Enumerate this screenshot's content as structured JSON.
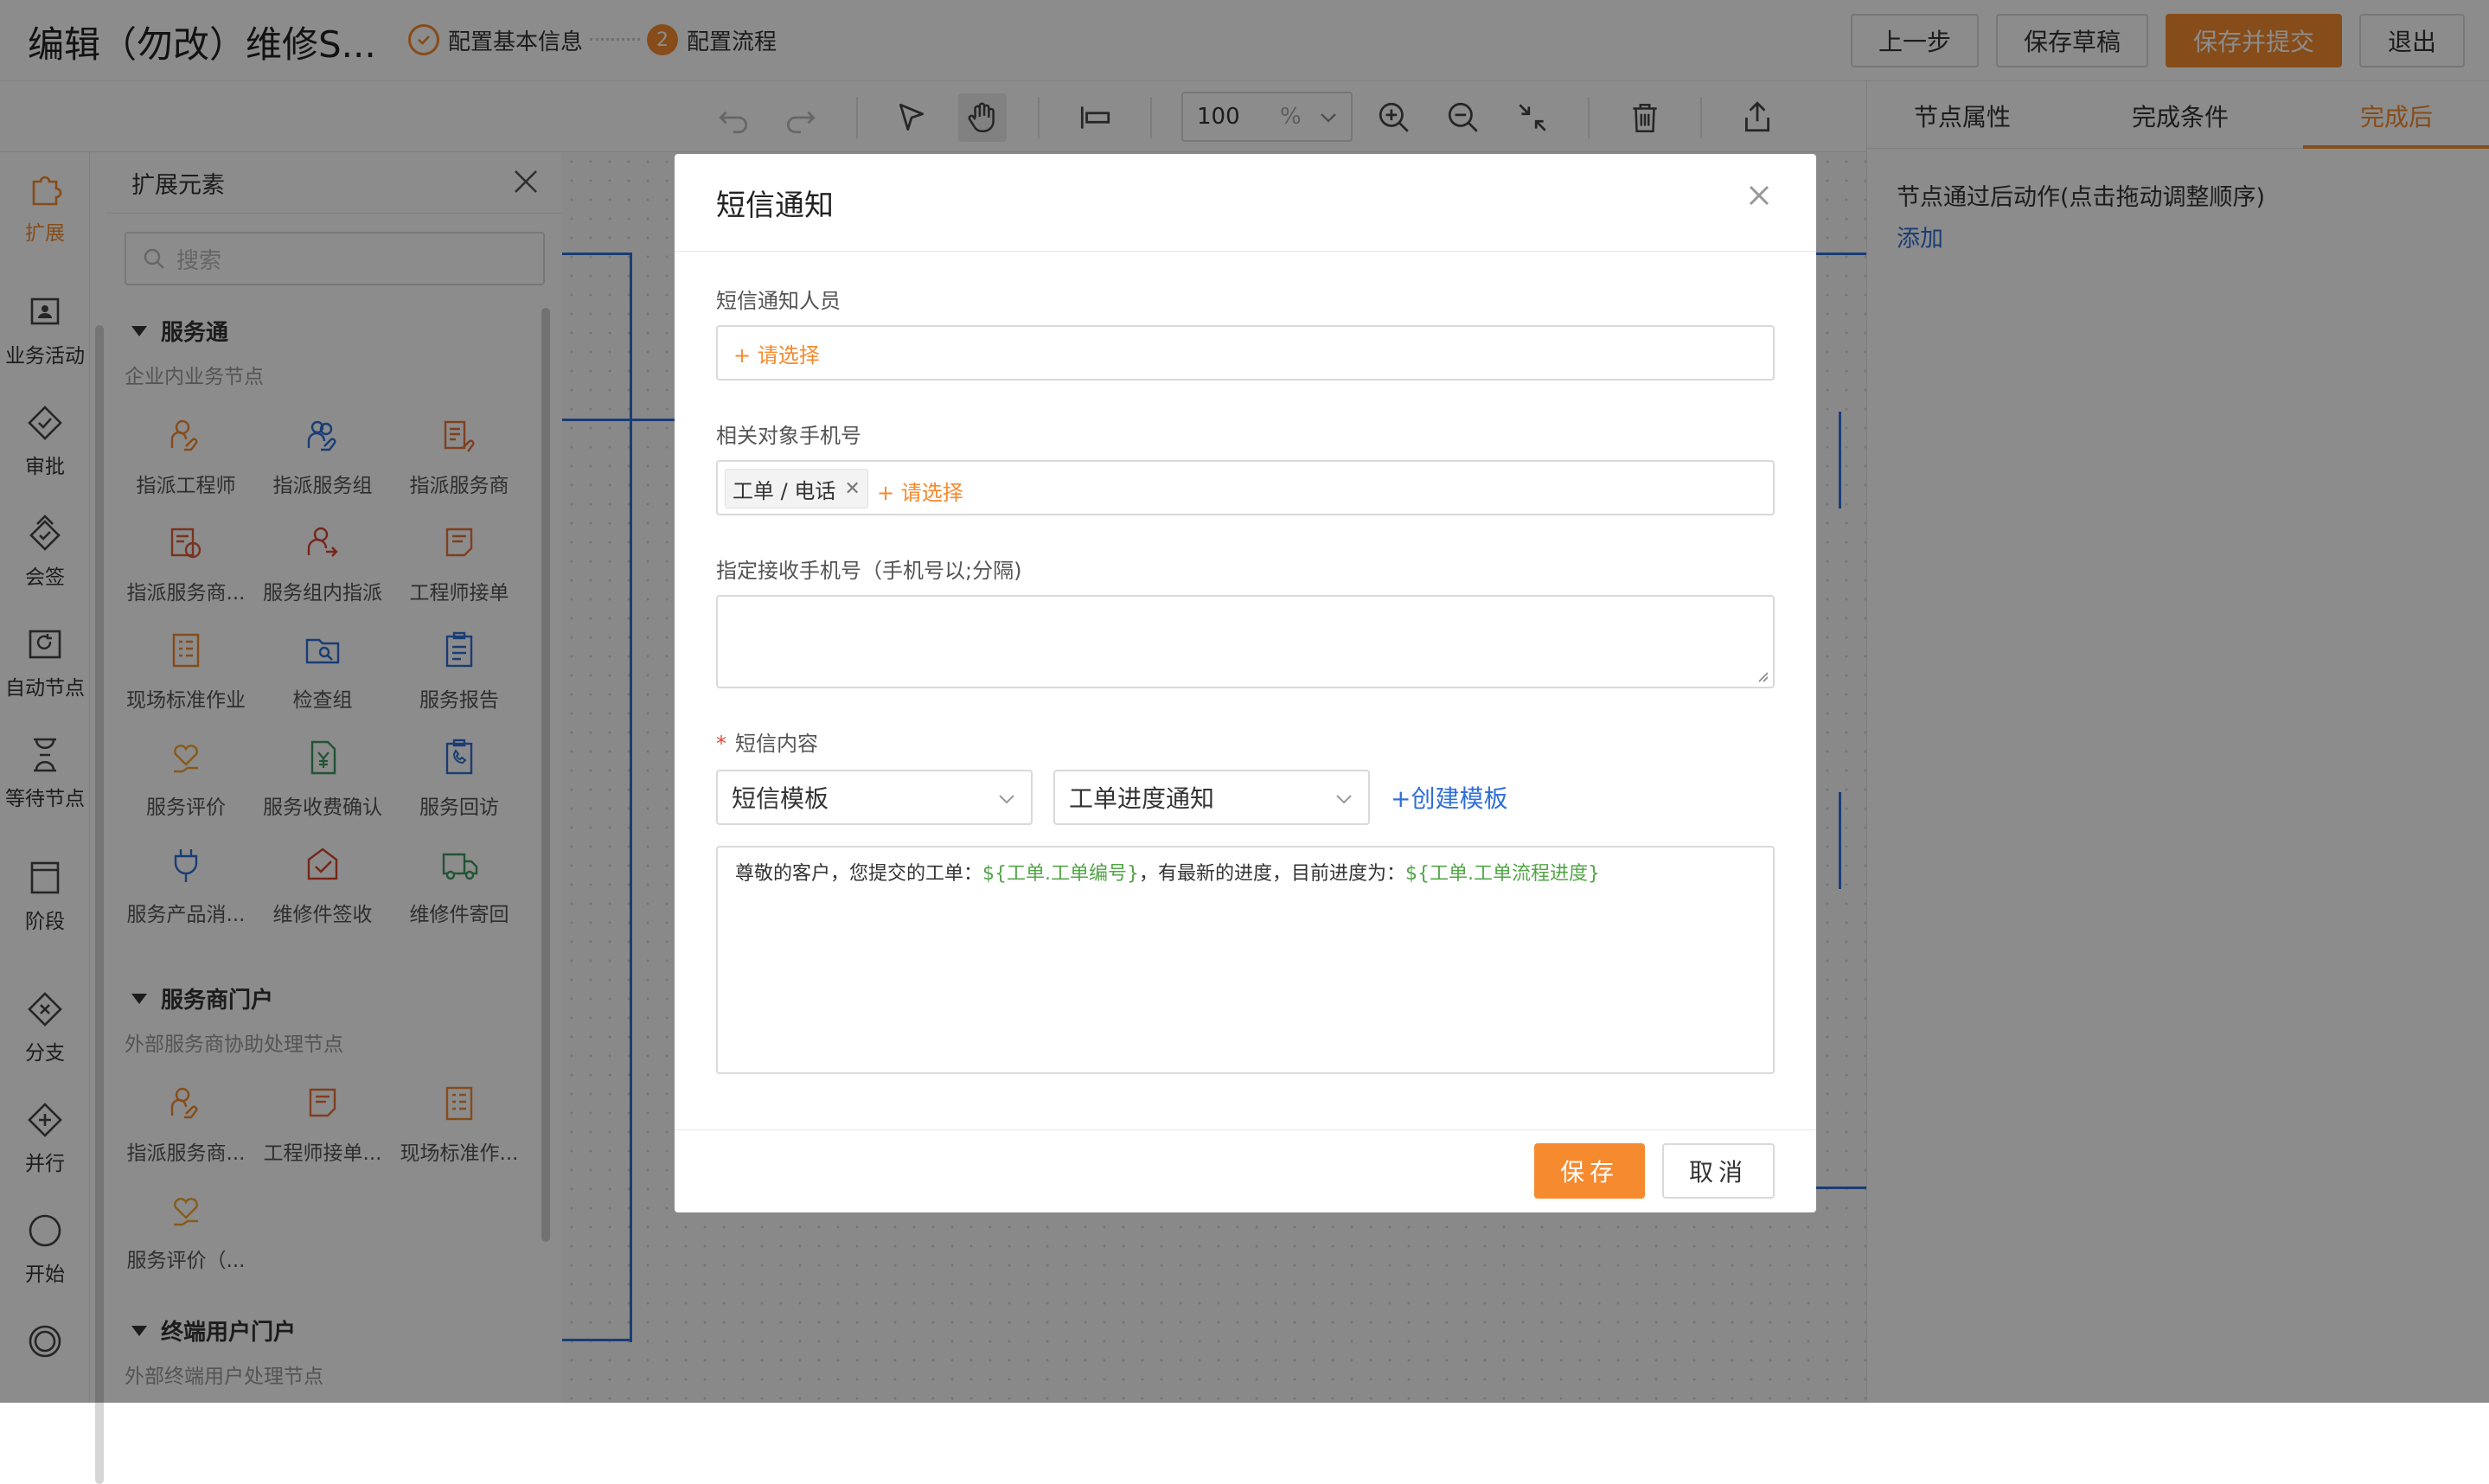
{
  "header": {
    "title": "编辑（勿改）维修S...",
    "steps": [
      {
        "number": "",
        "label": "配置基本信息"
      },
      {
        "number": "2",
        "label": "配置流程"
      }
    ],
    "buttons": {
      "prev": "上一步",
      "save_draft": "保存草稿",
      "save_submit": "保存并提交",
      "exit": "退出"
    },
    "accent_color": "#f58a2e"
  },
  "toolbar": {
    "zoom_value": "100",
    "zoom_unit": "%"
  },
  "right_panel": {
    "tabs": [
      "节点属性",
      "完成条件",
      "完成后"
    ],
    "active_tab": "完成后",
    "description": "节点通过后动作(点击拖动调整顺序)",
    "add_link": "添加"
  },
  "left_bar": {
    "items": [
      {
        "label": "扩展",
        "icon": "puzzle-icon"
      },
      {
        "label": "业务活动",
        "icon": "user-card-icon"
      },
      {
        "label": "审批",
        "icon": "diamond-check-icon"
      },
      {
        "label": "会签",
        "icon": "diamond-double-icon"
      },
      {
        "label": "自动节点",
        "icon": "auto-refresh-icon"
      },
      {
        "label": "等待节点",
        "icon": "hourglass-icon"
      },
      {
        "label": "阶段",
        "icon": "stage-icon"
      },
      {
        "label": "分支",
        "icon": "diamond-x-icon"
      },
      {
        "label": "并行",
        "icon": "diamond-plus-icon"
      },
      {
        "label": "开始",
        "icon": "circle-icon"
      },
      {
        "label": "",
        "icon": "end-circle-icon"
      }
    ]
  },
  "ext_panel": {
    "title": "扩展元素",
    "search_placeholder": "搜索",
    "groups": [
      {
        "title": "服务通",
        "desc": "企业内业务节点",
        "items": [
          "指派工程师",
          "指派服务组",
          "指派服务商",
          "指派服务商...",
          "服务组内指派",
          "工程师接单",
          "现场标准作业",
          "检查组",
          "服务报告",
          "服务评价",
          "服务收费确认",
          "服务回访",
          "服务产品消...",
          "维修件签收",
          "维修件寄回"
        ]
      },
      {
        "title": "服务商门户",
        "desc": "外部服务商协助处理节点",
        "items": [
          "指派服务商...",
          "工程师接单...",
          "现场标准作...",
          "服务评价（..."
        ]
      },
      {
        "title": "终端用户门户",
        "desc": "外部终端用户处理节点",
        "items": []
      }
    ]
  },
  "modal": {
    "title": "短信通知",
    "fields": {
      "notify_people_label": "短信通知人员",
      "notify_people_pick": "+ 请选择",
      "related_phone_label": "相关对象手机号",
      "related_phone_chip": "工单 / 电话",
      "related_phone_pick": "+ 请选择",
      "specified_phone_label": "指定接收手机号（手机号以;分隔)",
      "specified_phone_value": "",
      "content_label": "短信内容",
      "template_type": "短信模板",
      "template_name": "工单进度通知",
      "create_template": "+创建模板",
      "content_parts": {
        "p1": "尊敬的客户，您提交的工单：",
        "v1": "${工单.工单编号}",
        "p2": "，有最新的进度，目前进度为：",
        "v2": "${工单.工单流程进度}"
      }
    },
    "buttons": {
      "save": "保存",
      "cancel": "取消"
    }
  }
}
